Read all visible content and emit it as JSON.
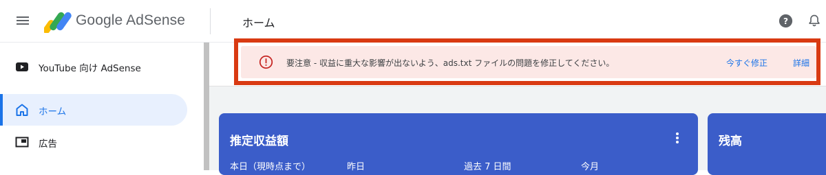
{
  "header": {
    "brand": "Google AdSense",
    "page_title": "ホーム",
    "menu_icon": "hamburger-menu-icon",
    "help_icon": "help-circle-icon",
    "bell_icon": "notification-bell-icon"
  },
  "sidebar": {
    "items": [
      {
        "label": "YouTube 向け AdSense",
        "icon": "youtube-icon",
        "active": false
      },
      {
        "label": "ホーム",
        "icon": "home-icon",
        "active": true
      },
      {
        "label": "広告",
        "icon": "ads-icon",
        "active": false
      }
    ]
  },
  "alert": {
    "icon": "alert-circle-icon",
    "message": "要注意 - 収益に重大な影響が出ないよう、ads.txt ファイルの問題を修正してください。",
    "fix_link": "今すぐ修正",
    "detail_link": "詳細",
    "highlight_color": "#d93a12"
  },
  "earnings_card": {
    "title": "推定収益額",
    "more_icon": "more-vertical-icon",
    "periods": [
      "本日（現時点まで）",
      "昨日",
      "過去 7 日間",
      "今月"
    ]
  },
  "balance_card": {
    "title": "残高"
  },
  "colors": {
    "accent": "#1a73e8",
    "card": "#3b5dc9",
    "alert_bg": "#fce8e6"
  }
}
